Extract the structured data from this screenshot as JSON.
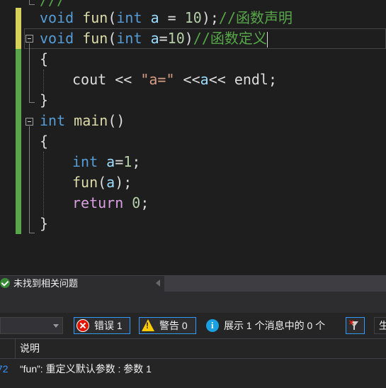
{
  "editor": {
    "line_partial": "///",
    "line1": {
      "kw": "void",
      "fn": "fun",
      "paren_open": "(",
      "type": "int",
      "param": "a",
      "rest": " = ",
      "num": "10",
      "close": ");",
      "comment": "//函数声明"
    },
    "line2": {
      "kw": "void",
      "fn": "fun",
      "paren_open": "(",
      "type": "int",
      "param": "a",
      "eq": "=",
      "num": "10",
      "close": ")",
      "comment": "//函数定义"
    },
    "line3": "{",
    "line4": {
      "cout": "cout",
      "op1": " << ",
      "str": "\"a=\"",
      "op2": " <<",
      "var": "a",
      "op3": "<< ",
      "endl": "endl",
      "semi": ";"
    },
    "line5": "}",
    "line6": {
      "kw": "int",
      "fn": "main",
      "parens": "()"
    },
    "line7": "{",
    "line8": {
      "kw": "int",
      "var": "a",
      "eq": "=",
      "num": "1",
      "semi": ";"
    },
    "line9": {
      "fn": "fun",
      "open": "(",
      "var": "a",
      "close": ");"
    },
    "line10": {
      "kw": "return",
      "num": "0",
      "semi": ";"
    },
    "line11": "}"
  },
  "statusbar": {
    "message": "未找到相关问题",
    "icon": "check-circle-icon"
  },
  "error_list": {
    "errors_label": "错误 1",
    "warnings_label": "警告 0",
    "messages_label": "展示 1 个消息中的 0 个",
    "partial_button": "生",
    "column_description": "说明",
    "rows": [
      {
        "code_fragment": "72",
        "description": "“fun”: 重定义默认参数 : 参数 1"
      }
    ]
  },
  "colors": {
    "keyword": "#569cd6",
    "function": "#dcdcaa",
    "number": "#b5cea8",
    "comment": "#57a64a",
    "string": "#d69d85",
    "control": "#d8a0df",
    "variable": "#9cdcfe",
    "change_saved": "#57a64a",
    "change_unsaved": "#d7d05a"
  }
}
